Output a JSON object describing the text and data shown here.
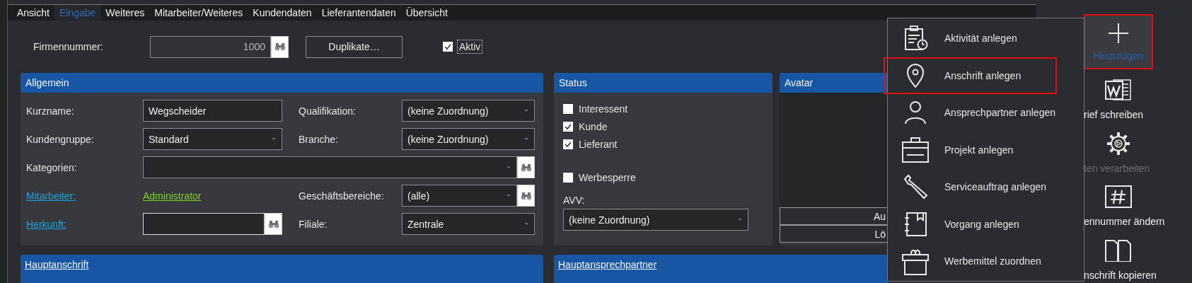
{
  "tabs": [
    {
      "label": "Ansicht",
      "selected": false
    },
    {
      "label": "Eingabe",
      "selected": true
    },
    {
      "label": "Weiteres",
      "selected": false
    },
    {
      "label": "Mitarbeiter/Weiteres",
      "selected": false
    },
    {
      "label": "Kundendaten",
      "selected": false
    },
    {
      "label": "Lieferantendaten",
      "selected": false
    },
    {
      "label": "Übersicht",
      "selected": false
    }
  ],
  "firm": {
    "label": "Firmennummer:",
    "value": "1000",
    "duplicate_button": "Duplikate…",
    "active": {
      "label": "Aktiv",
      "checked": true
    }
  },
  "general": {
    "title": "Allgemein",
    "rows": [
      {
        "cells": [
          {
            "label": "Kurzname:",
            "kind": "text",
            "value": "Wegscheider"
          },
          {
            "label": "Qualifikation:",
            "kind": "dropdown",
            "value": "(keine Zuordnung)"
          }
        ]
      },
      {
        "cells": [
          {
            "label": "Kundengruppe:",
            "kind": "dropdown",
            "value": "Standard"
          },
          {
            "label": "Branche:",
            "kind": "dropdown",
            "value": "(keine Zuordnung)"
          }
        ]
      },
      {
        "cells": [
          {
            "label": "Kategorien:",
            "kind": "dropdown-lookup"
          }
        ]
      },
      {
        "cells": [
          {
            "label": "Mitarbeiter:",
            "label_link": true,
            "kind": "link",
            "value": "Administrator"
          },
          {
            "label": "Geschäftsbereiche:",
            "kind": "dropdown-lookup",
            "value": "(alle)"
          }
        ]
      },
      {
        "cells": [
          {
            "label": "Herkunft:",
            "label_link": true,
            "kind": "lookup"
          },
          {
            "label": "Filiale:",
            "kind": "dropdown",
            "value": "Zentrale"
          }
        ]
      }
    ]
  },
  "status": {
    "title": "Status",
    "checks": [
      {
        "label": "Interessent",
        "checked": false
      },
      {
        "label": "Kunde",
        "checked": true
      },
      {
        "label": "Lieferant",
        "checked": true
      }
    ],
    "ad_block": {
      "label": "Werbesperre",
      "checked": false
    },
    "avv": {
      "label": "AVV:",
      "value": "(keine Zuordnung)"
    }
  },
  "avatar": {
    "title": "Avatar",
    "buttons": [
      "Au",
      "Lö"
    ]
  },
  "sections": [
    {
      "title": "Hauptanschrift"
    },
    {
      "title": "Hauptansprechpartner"
    }
  ],
  "menu": {
    "items": [
      {
        "label": "Aktivität anlegen",
        "highlighted": false
      },
      {
        "label": "Anschrift anlegen",
        "highlighted": true
      },
      {
        "label": "Ansprechpartner anlegen",
        "highlighted": false
      },
      {
        "label": "Projekt anlegen",
        "highlighted": false
      },
      {
        "label": "Serviceauftrag anlegen",
        "highlighted": false
      },
      {
        "label": "Vorgang anlegen",
        "highlighted": false
      },
      {
        "label": "Werbemittel zuordnen",
        "highlighted": false
      }
    ]
  },
  "toolbar": {
    "add_button": {
      "label": "Hinzufügen",
      "highlighted": true
    },
    "items": [
      {
        "label": "rief schreiben",
        "disabled": false
      },
      {
        "label": "ten verarbeiten",
        "disabled": true
      },
      {
        "label": "ennummer ändern",
        "disabled": false
      },
      {
        "label": "nschrift kopieren",
        "disabled": false
      }
    ]
  }
}
